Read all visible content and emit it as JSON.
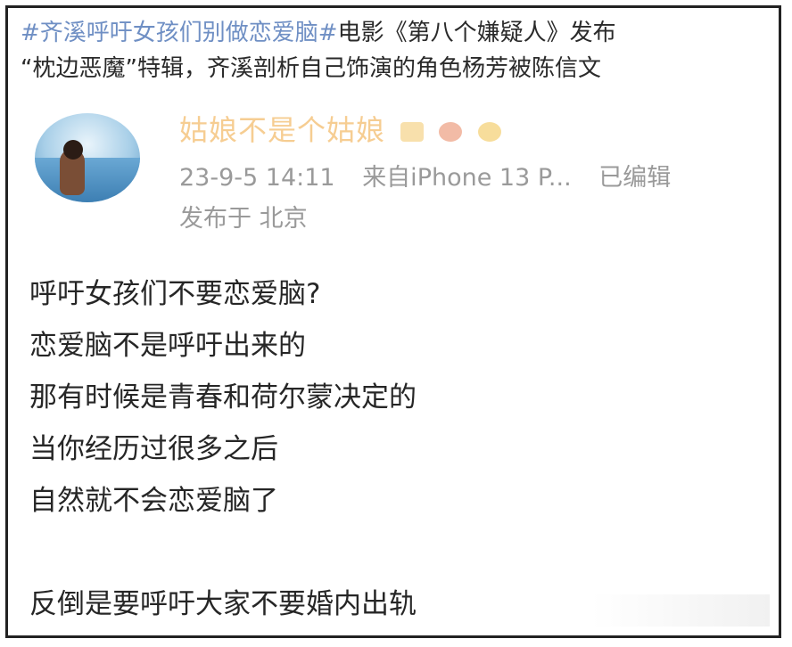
{
  "headline": {
    "hashtag": "#齐溪呼吁女孩们别做恋爱脑#",
    "text_line1": "电影《第八个嫌疑人》发布",
    "text_line2": "“枕边恶魔”特辑，齐溪剖析自己饰演的角色杨芳被陈信文"
  },
  "post": {
    "username": "姑娘不是个姑娘",
    "avatar_icon": "profile-photo",
    "emoji_icons": [
      "crown-badge-icon",
      "dog-face-icon",
      "fish-face-icon"
    ],
    "timestamp": "23-9-5 14:11",
    "source": "来自iPhone 13 P...",
    "edited": "已编辑",
    "location": "发布于 北京",
    "lines": [
      "呼吁女孩们不要恋爱脑?",
      "恋爱脑不是呼吁出来的",
      "那有时候是青春和荷尔蒙决定的",
      "当你经历过很多之后",
      "自然就不会恋爱脑了",
      "",
      "反倒是要呼吁大家不要婚内出轨"
    ]
  },
  "colors": {
    "hashtag": "#6f8fc4",
    "username": "#f0a53a",
    "meta": "#9a9a9a",
    "border": "#222222"
  }
}
